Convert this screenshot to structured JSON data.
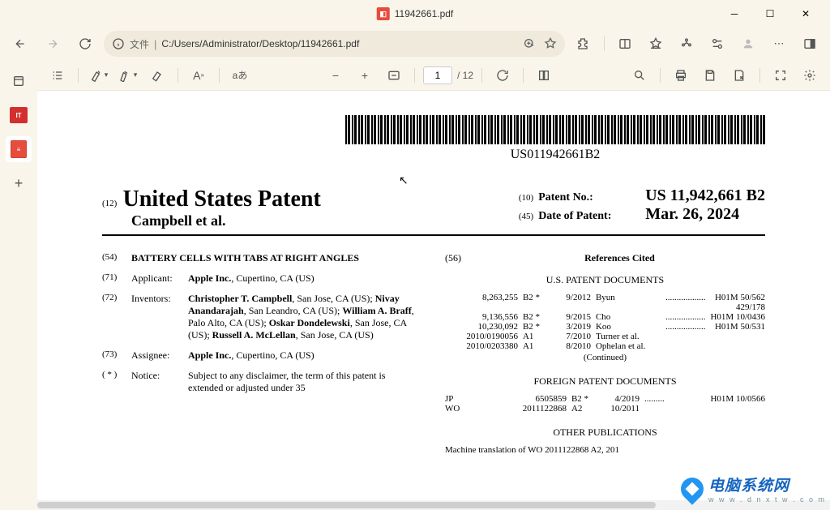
{
  "window": {
    "title": "11942661.pdf"
  },
  "addressbar": {
    "file_label": "文件",
    "url": "C:/Users/Administrator/Desktop/11942661.pdf"
  },
  "toolbar": {
    "page_current": "1",
    "page_total": "/ 12",
    "translate_label": "aあ"
  },
  "sidebar": {
    "it_label": "IT"
  },
  "document": {
    "barcode_text": "US011942661B2",
    "header": {
      "code12": "(12)",
      "title_main": "United States Patent",
      "subtitle": "Campbell et al.",
      "code10": "(10)",
      "patent_no_label": "Patent No.:",
      "patent_no": "US 11,942,661 B2",
      "code45": "(45)",
      "date_label": "Date of Patent:",
      "date": "Mar. 26, 2024"
    },
    "fields": {
      "f54_num": "(54)",
      "f54_val": "BATTERY CELLS WITH TABS AT RIGHT ANGLES",
      "f71_num": "(71)",
      "f71_label": "Applicant:",
      "f71_val": "Apple Inc., Cupertino, CA (US)",
      "f72_num": "(72)",
      "f72_label": "Inventors:",
      "f72_val": "Christopher T. Campbell, San Jose, CA (US); Nivay Anandarajah, San Leandro, CA (US); William A. Braff, Palo Alto, CA (US); Oskar Dondelewski, San Jose, CA (US); Russell A. McLellan, San Jose, CA (US)",
      "f73_num": "(73)",
      "f73_label": "Assignee:",
      "f73_val": "Apple Inc., Cupertino, CA (US)",
      "fstar_num": "( * )",
      "fstar_label": "Notice:",
      "fstar_val": "Subject to any disclaimer, the term of this patent is extended or adjusted under 35",
      "f56_num": "(56)",
      "references_cited": "References Cited",
      "us_docs": "U.S. PATENT DOCUMENTS",
      "foreign_docs": "FOREIGN PATENT DOCUMENTS",
      "other_pubs": "OTHER PUBLICATIONS",
      "continued": "(Continued)",
      "machine_trans": "Machine translation of WO 2011122868 A2, 201"
    },
    "us_refs": [
      {
        "no": "8,263,255",
        "type": "B2 *",
        "date": "9/2012",
        "name": "Byun",
        "cls": "H01M 50/562",
        "extra": "429/178"
      },
      {
        "no": "9,136,556",
        "type": "B2 *",
        "date": "9/2015",
        "name": "Cho",
        "cls": "H01M 10/0436"
      },
      {
        "no": "10,230,092",
        "type": "B2 *",
        "date": "3/2019",
        "name": "Koo",
        "cls": "H01M 50/531"
      },
      {
        "no": "2010/0190056",
        "type": "A1",
        "date": "7/2010",
        "name": "Turner et al."
      },
      {
        "no": "2010/0203380",
        "type": "A1",
        "date": "8/2010",
        "name": "Ophelan et al."
      }
    ],
    "foreign_refs": [
      {
        "cc": "JP",
        "no": "6505859",
        "type": "B2 *",
        "date": "4/2019",
        "cls": "H01M 10/0566"
      },
      {
        "cc": "WO",
        "no": "2011122868",
        "type": "A2",
        "date": "10/2011"
      }
    ]
  },
  "watermark": {
    "cn_text": "电脑系统网",
    "url_text": "w w w . d n x t w . c o m"
  }
}
